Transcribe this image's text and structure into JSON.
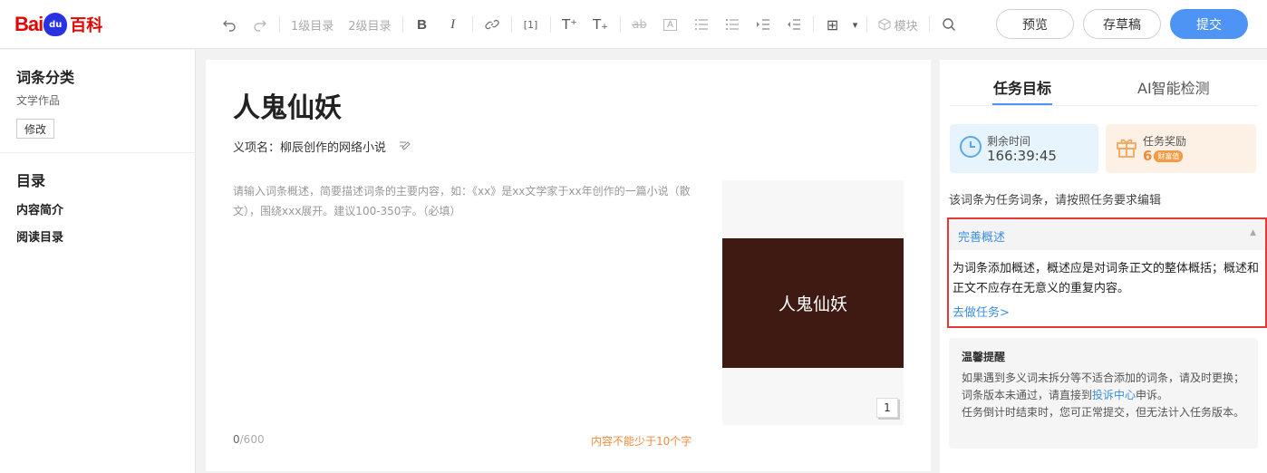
{
  "logo": {
    "bai": "Bai",
    "du": "du",
    "baike": "百科"
  },
  "toolbar": {
    "undo_icon": "undo-icon",
    "redo_icon": "redo-icon",
    "h1": "1级目录",
    "h2": "2级目录",
    "bold": "B",
    "italic": "I",
    "link_icon": "link-icon",
    "ref": "[1]",
    "sup": "T⁺",
    "sub": "T₊",
    "strike": "ab",
    "textbox": "A",
    "olist_icon": "ordered-list-icon",
    "ulist_icon": "unordered-list-icon",
    "indent_icon": "indent-icon",
    "outdent_icon": "outdent-icon",
    "insert": "⊞",
    "insert_arrow": "▾",
    "module": "模块",
    "search_icon": "search-icon"
  },
  "actions": {
    "preview": "预览",
    "draft": "存草稿",
    "submit": "提交"
  },
  "sidebar": {
    "category_title": "词条分类",
    "category_value": "文学作品",
    "modify": "修改",
    "toc_title": "目录",
    "toc_items": [
      "内容简介",
      "阅读目录"
    ]
  },
  "editor": {
    "title": "人鬼仙妖",
    "sense_label": "义项名：",
    "sense_value": "柳辰创作的网络小说",
    "summary_placeholder": "请输入词条概述，简要描述词条的主要内容，如：《xx》是xx文学家于xx年创作的一篇小说（散文），围绕xxx展开。建议100-350字。（必填）",
    "count_current": "0",
    "count_max": "/600",
    "min_warning": "内容不能少于10个字",
    "cover_title": "人鬼仙妖",
    "cover_count": "1"
  },
  "panel": {
    "tabs": [
      "任务目标",
      "AI智能检测"
    ],
    "time_label": "剩余时间",
    "time_value": "166:39:45",
    "reward_label": "任务奖励",
    "reward_value": "6",
    "reward_tag": "财富值",
    "hint": "该词条为任务词条，请按照任务要求编辑",
    "task_title": "完善概述",
    "task_desc": "为词条添加概述，概述应是对词条正文的整体概括；概述和正文不应存在无意义的重复内容。",
    "task_link": "去做任务>",
    "tips_title": "温馨提醒",
    "tips_text_1": "如果遇到多义词未拆分等不适合添加的词条，请及时更换；词条版本未通过，请直接到",
    "tips_link": "投诉中心",
    "tips_text_2": "申诉。",
    "tips_text_3": "任务倒计时结束时，您可正常提交，但无法计入任务版本。"
  }
}
